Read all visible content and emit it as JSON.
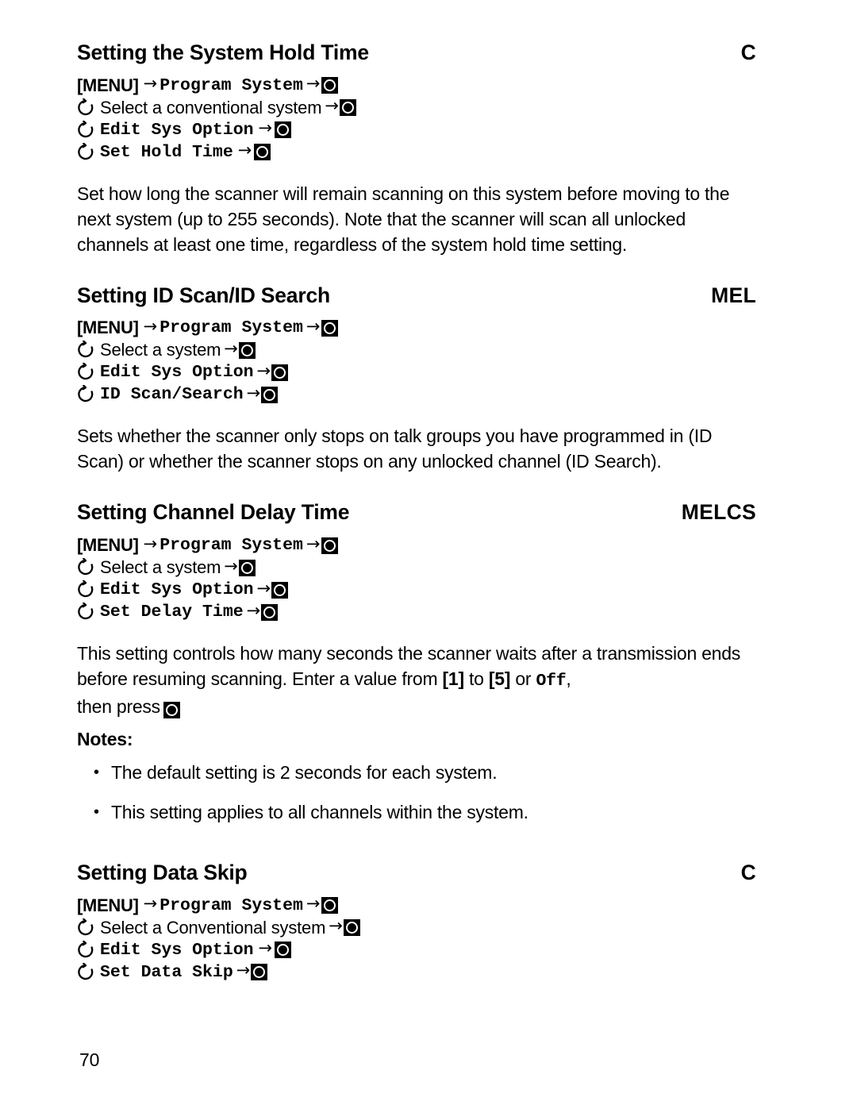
{
  "page": {
    "number": "70",
    "background": "#ffffff",
    "text_color": "#000000"
  },
  "icons": {
    "key": "key-round-button-icon",
    "turn": "rotate-knob-icon",
    "arrow": "→"
  },
  "sections": [
    {
      "id": "system-hold-time",
      "title": "Setting the System Hold Time",
      "code": "C",
      "menu_path": [
        {
          "menu_key": "[MENU]",
          "arrow1": "→",
          "command": "Program System",
          "arrow2": "→",
          "key": true
        },
        {
          "turn": true,
          "plain": "Select a conventional system",
          "arrow2": "→",
          "key": true
        },
        {
          "turn": true,
          "command": "Edit Sys Option",
          "arrow2": "→",
          "key": true
        },
        {
          "turn": true,
          "command": "Set Hold Time",
          "arrow2": "→",
          "key": true
        }
      ],
      "body": "Set how long the scanner will remain scanning on this system before moving to the next system (up to 255 seconds). Note that the scanner will scan all unlocked channels at least one time, regardless of the system hold time setting."
    },
    {
      "id": "id-scan-id-search",
      "title": "Setting ID Scan/ID Search",
      "code": "MEL",
      "menu_path": [
        {
          "menu_key": "[MENU]",
          "arrow1": "→",
          "command": "Program System",
          "arrow2": "→",
          "key": true
        },
        {
          "turn": true,
          "plain": "Select a system",
          "arrow2": "→",
          "key": true
        },
        {
          "turn": true,
          "command": "Edit Sys Option",
          "arrow2": "→",
          "key": true
        },
        {
          "turn": true,
          "command": "ID Scan/Search",
          "arrow2": "→",
          "key": true
        }
      ],
      "body": "Sets whether the scanner only stops on talk groups you have programmed in (ID Scan) or whether the scanner stops on any unlocked channel (ID Search)."
    },
    {
      "id": "channel-delay-time",
      "title": "Setting Channel Delay Time",
      "code": "MELCS",
      "menu_path": [
        {
          "menu_key": "[MENU]",
          "arrow1": "→",
          "command": "Program System",
          "arrow2": "→",
          "key": true
        },
        {
          "turn": true,
          "plain": "Select a system",
          "arrow2": "→",
          "key": true
        },
        {
          "turn": true,
          "command": "Edit Sys Option",
          "arrow2": "→",
          "key": true
        },
        {
          "turn": true,
          "command": "Set Delay Time",
          "arrow2": "→",
          "key": true
        }
      ],
      "body_parts": {
        "p1": "This setting controls how many seconds the scanner waits after a transmission ends before resuming scanning. Enter a value from ",
        "val_low": "[1]",
        "p2": " to ",
        "val_high": "[5]",
        "p3": " or ",
        "off": "Off",
        "p4": ",",
        "p5": "then press"
      },
      "notes_label": "Notes:",
      "notes": [
        "The default setting is 2 seconds for each system.",
        "This setting applies to all channels within the system."
      ]
    },
    {
      "id": "data-skip",
      "title": "Setting Data Skip",
      "code": "C",
      "menu_path": [
        {
          "menu_key": "[MENU]",
          "arrow1": "→",
          "command": "Program System",
          "arrow2": "→",
          "key": true
        },
        {
          "turn": true,
          "plain": "Select a Conventional system",
          "arrow2": "→",
          "key": true
        },
        {
          "turn": true,
          "command": "Edit Sys Option",
          "arrow2": "→",
          "key": true
        },
        {
          "turn": true,
          "command": "Set Data Skip",
          "arrow2": "→",
          "key": true
        }
      ]
    }
  ]
}
